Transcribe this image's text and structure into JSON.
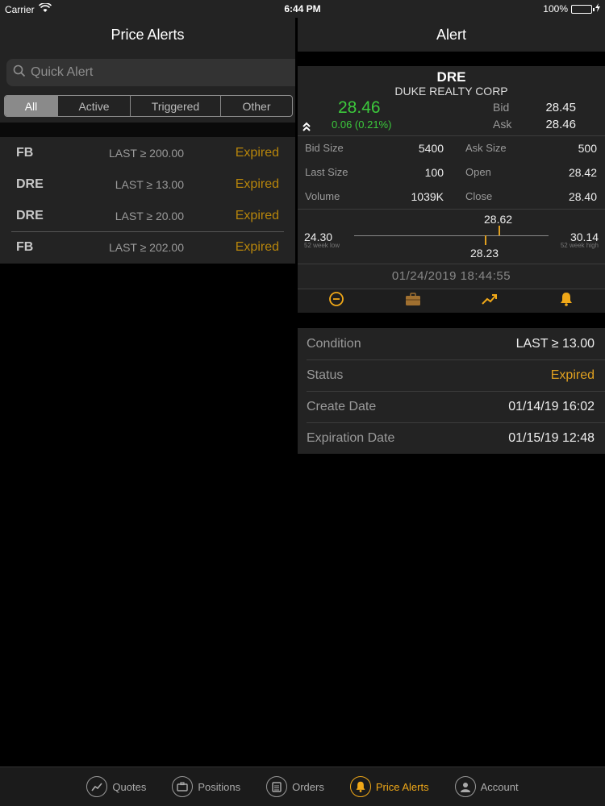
{
  "status_bar": {
    "carrier": "Carrier",
    "time": "6:44 PM",
    "battery": "100%",
    "battery_level": 1.0
  },
  "left": {
    "title": "Price Alerts",
    "search_placeholder": "Quick Alert",
    "segments": [
      "All",
      "Active",
      "Triggered",
      "Other"
    ],
    "selected_segment": "All",
    "alerts": [
      {
        "symbol": "FB",
        "condition": "LAST ≥ 200.00",
        "status": "Expired"
      },
      {
        "symbol": "DRE",
        "condition": "LAST ≥ 13.00",
        "status": "Expired"
      },
      {
        "symbol": "DRE",
        "condition": "LAST ≥ 20.00",
        "status": "Expired"
      },
      {
        "symbol": "FB",
        "condition": "LAST ≥ 202.00",
        "status": "Expired"
      }
    ]
  },
  "right": {
    "title": "Alert",
    "quote": {
      "symbol": "DRE",
      "name": "DUKE REALTY CORP",
      "last": "28.46",
      "change": "0.06 (0.21%)",
      "bid_label": "Bid",
      "bid": "28.45",
      "ask_label": "Ask",
      "ask": "28.46",
      "stats": [
        [
          {
            "label": "Bid Size",
            "value": "5400"
          },
          {
            "label": "Ask Size",
            "value": "500"
          }
        ],
        [
          {
            "label": "Last Size",
            "value": "100"
          },
          {
            "label": "Open",
            "value": "28.42"
          }
        ],
        [
          {
            "label": "Volume",
            "value": "1039K"
          },
          {
            "label": "Close",
            "value": "28.40"
          }
        ]
      ],
      "range": {
        "low": "24.30",
        "low_label": "52 week low",
        "high": "30.14",
        "high_label": "52 week high",
        "day_high": "28.62",
        "day_low": "28.23"
      },
      "timestamp": "01/24/2019 18:44:55",
      "toolbar_icons": [
        "minus-circle-icon",
        "briefcase-icon",
        "trend-up-icon",
        "bell-icon"
      ]
    },
    "details": [
      {
        "label": "Condition",
        "value": "LAST ≥ 13.00"
      },
      {
        "label": "Status",
        "value": "Expired"
      },
      {
        "label": "Create Date",
        "value": "01/14/19 16:02"
      },
      {
        "label": "Expiration Date",
        "value": "01/15/19 12:48"
      }
    ]
  },
  "tabbar": {
    "tabs": [
      {
        "label": "Quotes",
        "icon": "trend-up-icon"
      },
      {
        "label": "Positions",
        "icon": "briefcase-icon"
      },
      {
        "label": "Orders",
        "icon": "clipboard-icon"
      },
      {
        "label": "Price Alerts",
        "icon": "bell-icon"
      },
      {
        "label": "Account",
        "icon": "person-icon"
      }
    ],
    "active": "Price Alerts"
  },
  "colors": {
    "accent": "#f0a818",
    "up": "#3cc93c",
    "panel": "#232323",
    "background": "#000000"
  }
}
